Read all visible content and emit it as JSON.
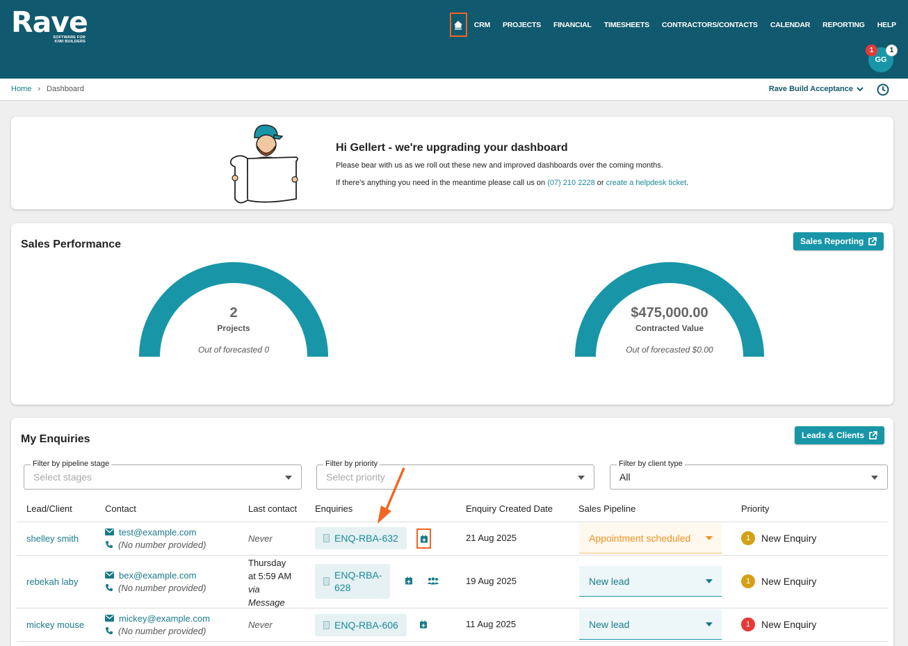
{
  "app": {
    "logo": "Rave",
    "tagline": "SOFTWARE FOR KIWI BUILDERS"
  },
  "nav": {
    "items": [
      "CRM",
      "PROJECTS",
      "FINANCIAL",
      "TIMESHEETS",
      "CONTRACTORS/CONTACTS",
      "CALENDAR",
      "REPORTING",
      "HELP"
    ]
  },
  "user": {
    "initials": "GG",
    "notifications": "1",
    "messages": "1"
  },
  "breadcrumb": {
    "home": "Home",
    "sep": "›",
    "current": "Dashboard"
  },
  "org": {
    "name": "Rave Build Acceptance"
  },
  "welcome": {
    "title": "Hi Gellert - we're upgrading your dashboard",
    "line1": "Please bear with us as we roll out these new and improved dashboards over the coming months.",
    "line2_prefix": "If there's anything you need in the meantime please call us on ",
    "phone": "(07) 210 2228",
    "or": " or ",
    "helpdesk": "create a helpdesk ticket",
    "period": "."
  },
  "sales": {
    "title": "Sales Performance",
    "button": "Sales Reporting",
    "gauges": [
      {
        "value": "2",
        "label": "Projects",
        "sub": "Out of forecasted 0"
      },
      {
        "value": "$475,000.00",
        "label": "Contracted Value",
        "sub": "Out of forecasted $0.00"
      }
    ]
  },
  "enquiries": {
    "title": "My Enquiries",
    "button": "Leads & Clients",
    "filters": [
      {
        "label": "Filter by pipeline stage",
        "value": "Select stages",
        "placeholder": true
      },
      {
        "label": "Filter by priority",
        "value": "Select priority",
        "placeholder": true
      },
      {
        "label": "Filter by client type",
        "value": "All",
        "placeholder": false
      }
    ],
    "columns": [
      "Lead/Client",
      "Contact",
      "Last contact",
      "Enquiries",
      "Enquiry Created Date",
      "Sales Pipeline",
      "Priority"
    ],
    "rows": [
      {
        "lead": "shelley smith",
        "email": "test@example.com",
        "phone": "(No number provided)",
        "last": "Never",
        "enquiry": "ENQ-RBA-632",
        "date": "21 Aug 2025",
        "pipeline": "Appointment scheduled",
        "priority_num": "1",
        "priority": "New Enquiry",
        "priority_color": "#d4a017"
      },
      {
        "lead": "rebekah laby",
        "email": "bex@example.com",
        "phone": "(No number provided)",
        "last_l1": "Thursday",
        "last_l2": "at 5:59 AM",
        "last_l3": "via",
        "last_l4": "Message",
        "enquiry_l1": "ENQ-RBA-",
        "enquiry_l2": "628",
        "date": "19 Aug 2025",
        "pipeline": "New lead",
        "priority_num": "1",
        "priority": "New Enquiry",
        "priority_color": "#d4a017"
      },
      {
        "lead": "mickey mouse",
        "email": "mickey@example.com",
        "phone": "(No number provided)",
        "last": "Never",
        "enquiry": "ENQ-RBA-606",
        "date": "11 Aug 2025",
        "pipeline": "New lead",
        "priority_num": "1",
        "priority": "New Enquiry",
        "priority_color": "#e53935"
      }
    ]
  },
  "colors": {
    "header": "#11596e",
    "accent": "#1896a8",
    "highlight": "#f26522"
  }
}
